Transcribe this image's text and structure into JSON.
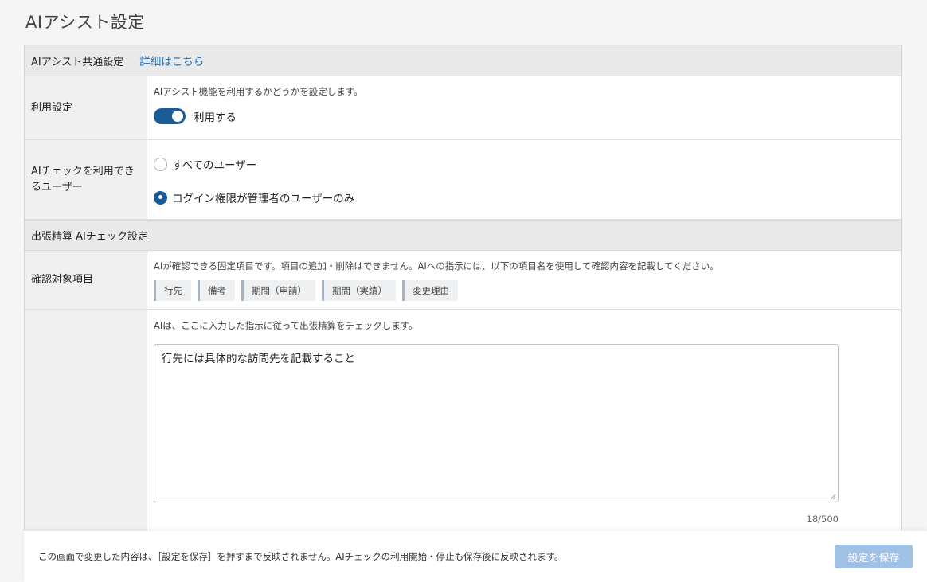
{
  "page": {
    "title": "AIアシスト設定"
  },
  "common": {
    "header": "AIアシスト共通設定",
    "link": "詳細はこちら",
    "usage": {
      "label": "利用設定",
      "description": "AIアシスト機能を利用するかどうかを設定します。",
      "toggle_label": "利用する",
      "enabled": true
    },
    "users": {
      "label": "AIチェックを利用できるユーザー",
      "options": [
        "すべてのユーザー",
        "ログイン権限が管理者のユーザーのみ"
      ],
      "selected_index": 1
    }
  },
  "travel": {
    "header": "出張精算 AIチェック設定",
    "target": {
      "label": "確認対象項目",
      "description": "AIが確認できる固定項目です。項目の追加・削除はできません。AIへの指示には、以下の項目名を使用して確認内容を記載してください。",
      "tags": [
        "行先",
        "備考",
        "期間（申請）",
        "期間（実績）",
        "変更理由"
      ]
    },
    "instruction": {
      "description": "AIは、ここに入力した指示に従って出張精算をチェックします。",
      "value": "行先には具体的な訪問先を記載すること",
      "counter": "18/500"
    }
  },
  "footer": {
    "notice": "この画面で変更した内容は、［設定を保存］を押すまで反映されません。AIチェックの利用開始・停止も保存後に反映されます。",
    "save_label": "設定を保存"
  },
  "colors": {
    "accent": "#1b5c97",
    "link": "#1f72b8",
    "save_disabled": "#9fc1e5"
  }
}
